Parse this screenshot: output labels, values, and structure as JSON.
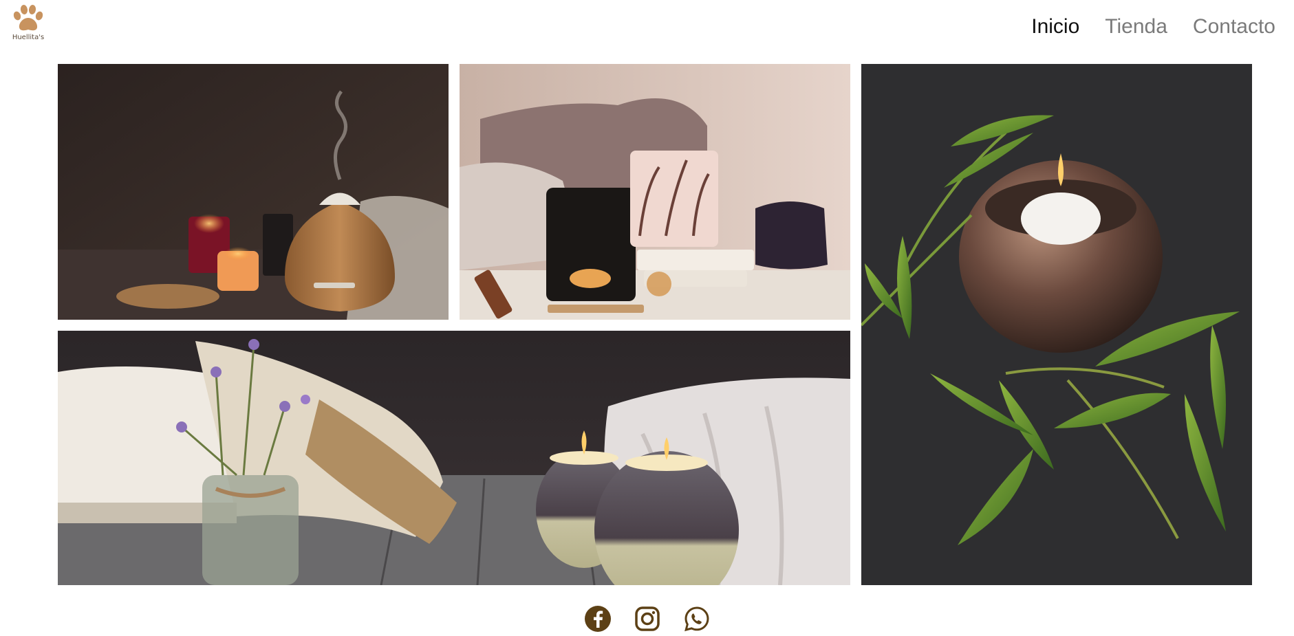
{
  "brand": {
    "name": "Huellita's",
    "logo_icon": "paw-icon",
    "logo_color": "#c8935f"
  },
  "nav": {
    "items": [
      {
        "label": "Inicio",
        "active": true
      },
      {
        "label": "Tienda",
        "active": false
      },
      {
        "label": "Contacto",
        "active": false
      }
    ]
  },
  "gallery": {
    "images": [
      {
        "name": "aroma-diffuser-candles-photo"
      },
      {
        "name": "cozy-candle-holders-photo"
      },
      {
        "name": "floating-candle-bamboo-photo"
      },
      {
        "name": "book-lavender-candles-photo"
      }
    ]
  },
  "social": {
    "icons": [
      "facebook-icon",
      "instagram-icon",
      "whatsapp-icon"
    ],
    "color": "#5c4015"
  }
}
